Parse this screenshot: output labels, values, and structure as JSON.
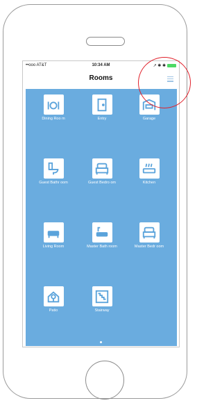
{
  "status": {
    "carrier": "••ooo AT&T ",
    "time": "10:34 AM",
    "right_icons": "↗ ✱ ✱"
  },
  "nav": {
    "title": "Rooms"
  },
  "icons": {
    "menu": "hamburger-menu-icon"
  },
  "rooms": [
    {
      "label": "Dining Roo m",
      "icon": "dining-icon"
    },
    {
      "label": "Entry",
      "icon": "door-icon"
    },
    {
      "label": "Garage",
      "icon": "garage-icon"
    },
    {
      "label": "Guest Bathr oom",
      "icon": "toilet-icon"
    },
    {
      "label": "Guest Bedro om",
      "icon": "bed-icon"
    },
    {
      "label": "Kitchen",
      "icon": "stove-icon"
    },
    {
      "label": "Living Room",
      "icon": "sofa-icon"
    },
    {
      "label": "Master Bath room",
      "icon": "bathtub-icon"
    },
    {
      "label": "Master Bedr oom",
      "icon": "bed-icon"
    },
    {
      "label": "Patio",
      "icon": "patio-icon"
    },
    {
      "label": "Stairway",
      "icon": "stairs-icon"
    }
  ],
  "colors": {
    "background": "#6aacdf",
    "icon_color": "#5aa3db",
    "annotation": "#e0202a"
  }
}
